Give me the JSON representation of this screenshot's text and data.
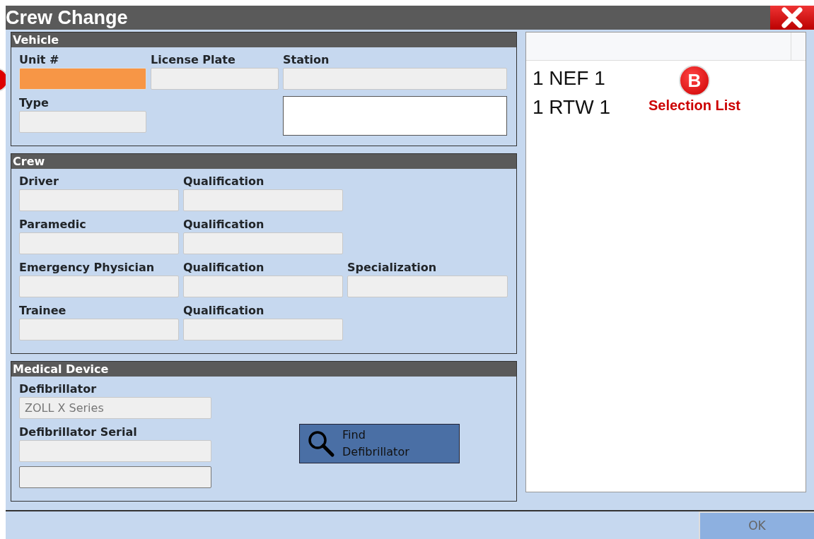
{
  "window": {
    "title": "Crew Change"
  },
  "sections": [
    {
      "title": "Vehicle",
      "kind": "vehicle",
      "fields": [
        {
          "label": "Unit #",
          "kind": "field",
          "focused": true
        },
        {
          "label": "License Plate",
          "kind": "field",
          "focused": false
        },
        {
          "label": "Station",
          "kind": "field",
          "focused": false
        },
        {
          "label": "Type",
          "kind": "field",
          "focused": false
        },
        {
          "kind": "spacer"
        },
        {
          "kind": "memo"
        }
      ]
    },
    {
      "title": "Crew",
      "kind": "crew",
      "fields": [
        {
          "label": "Driver",
          "kind": "field",
          "focused": false
        },
        {
          "label": "Qualification",
          "kind": "field",
          "focused": false
        },
        {
          "kind": "spacer"
        },
        {
          "label": "Paramedic",
          "kind": "field",
          "focused": false
        },
        {
          "label": "Qualification",
          "kind": "field",
          "focused": false
        },
        {
          "kind": "spacer"
        },
        {
          "label": "Emergency Physician",
          "kind": "field",
          "focused": false
        },
        {
          "label": "Qualification",
          "kind": "field",
          "focused": false
        },
        {
          "label": "Specialization",
          "kind": "field",
          "focused": false
        },
        {
          "label": "Trainee",
          "kind": "field",
          "focused": false
        },
        {
          "label": "Qualification",
          "kind": "field",
          "focused": false
        },
        {
          "kind": "spacer"
        }
      ]
    },
    {
      "title": "Medical Device",
      "kind": "device",
      "fields": [
        {
          "label": "Defibrillator",
          "kind": "field",
          "value": "ZOLL X Series",
          "focused": false
        },
        {
          "label": "Defibrillator Serial",
          "kind": "field",
          "focused": false
        },
        {
          "kind": "extra"
        }
      ],
      "button": {
        "label": "Find Defibrillator"
      }
    }
  ],
  "selection_list": {
    "items": [
      "1 NEF 1",
      "1 RTW 1"
    ]
  },
  "callout": {
    "letter": "B",
    "label": "Selection List"
  },
  "ok_button": {
    "label": "OK",
    "disabled": true
  }
}
